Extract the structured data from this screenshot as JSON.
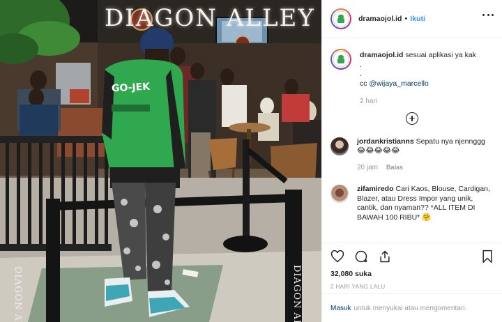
{
  "header": {
    "username": "dramaojol.id",
    "separator": "•",
    "follow_label": "Ikuti"
  },
  "photo": {
    "sign_text": "DIAGON ALLEY",
    "jacket_text": "GO-JEK",
    "post_text": "DIAGON ALLEY"
  },
  "caption": {
    "username": "dramaojol.id",
    "text": "sesuai aplikasi ya kak",
    "dot1": ".",
    "dot2": ".",
    "cc_prefix": "cc ",
    "mention": "@wijaya_marcello",
    "time": "2 hari"
  },
  "comments": [
    {
      "username": "jordankristianns",
      "text": "Sepatu nya njennggg 😂😂😂😂😂",
      "time": "20 jam",
      "reply_label": "Balas"
    },
    {
      "username": "zifamiredo",
      "text": "Cari Kaos, Blouse, Cardigan, Blazer, atau Dress Impor yang unik, cantik, dan nyaman?? *ALL ITEM DI BAWAH 100 RIBU* 🤗"
    }
  ],
  "actions": {
    "icons": [
      "heart-icon",
      "comment-icon",
      "share-icon",
      "bookmark-icon"
    ],
    "likes_text": "32,080 suka",
    "date_text": "2 HARI YANG LALU"
  },
  "login": {
    "link": "Masuk",
    "text": "untuk menyukai atau mengomentari."
  },
  "colors": {
    "link_blue": "#3897f0",
    "mention_navy": "#003569",
    "muted_gray": "#999999",
    "jacket_green": "#2fa84f"
  }
}
